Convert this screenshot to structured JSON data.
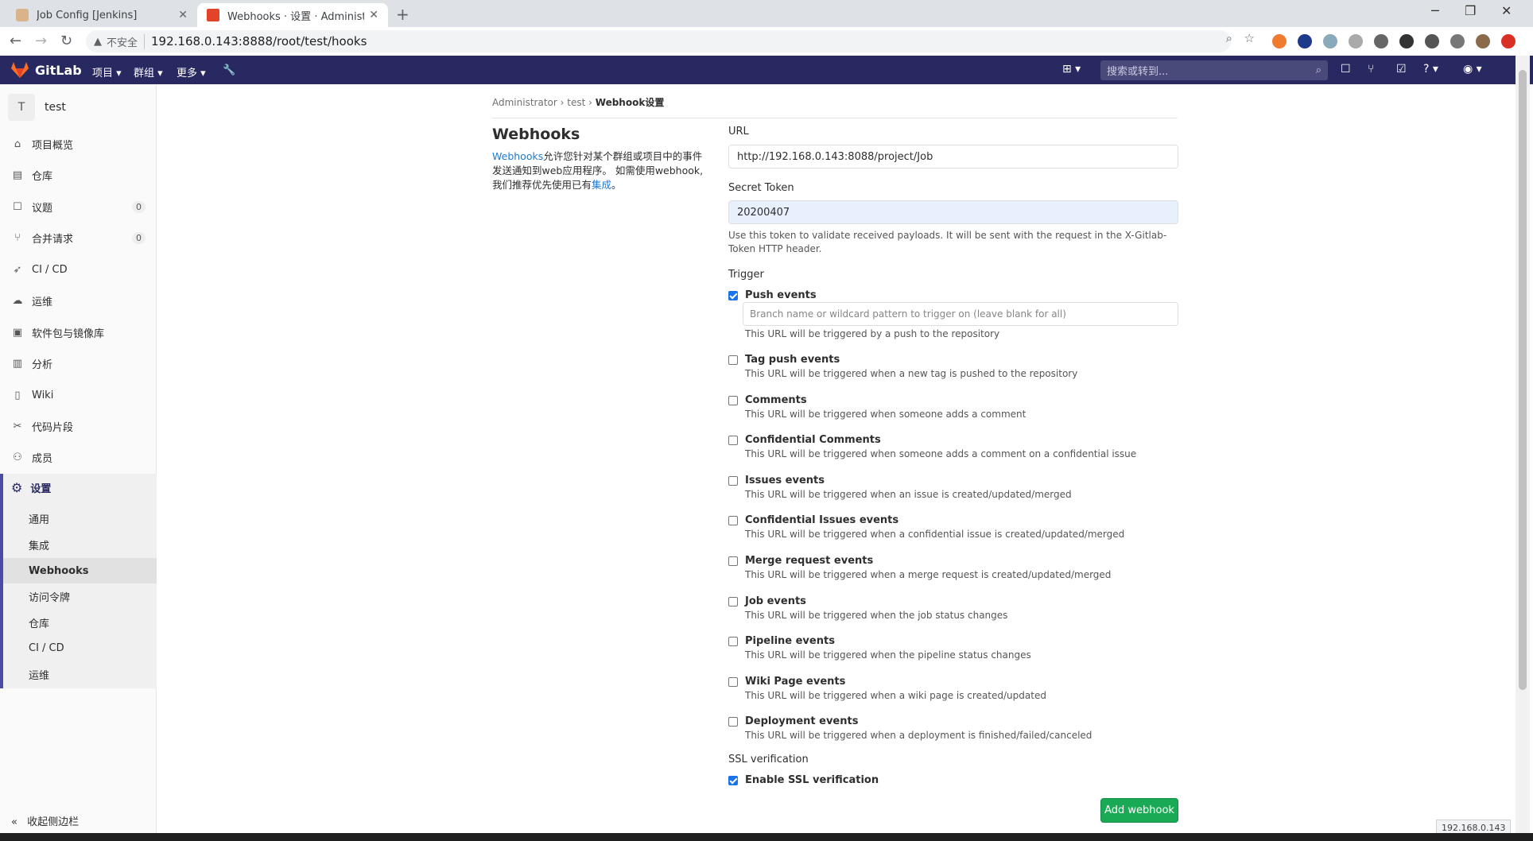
{
  "browser": {
    "tabs": [
      {
        "title": "Job Config [Jenkins]"
      },
      {
        "title": "Webhooks · 设置 · Administrat"
      }
    ],
    "insecure_label": "不安全",
    "url": "192.168.0.143:8888/root/test/hooks"
  },
  "gitlab": {
    "logo": "GitLab",
    "menu": {
      "projects": "项目",
      "groups": "群组",
      "more": "更多"
    },
    "search_placeholder": "搜索或转到..."
  },
  "sidebar": {
    "project_initial": "T",
    "project_name": "test",
    "items": [
      {
        "label": "项目概览",
        "icon": "home-icon"
      },
      {
        "label": "仓库",
        "icon": "doc-icon"
      },
      {
        "label": "议题",
        "icon": "issues-icon",
        "count": "0"
      },
      {
        "label": "合并请求",
        "icon": "merge-icon",
        "count": "0"
      },
      {
        "label": "CI / CD",
        "icon": "rocket-icon"
      },
      {
        "label": "运维",
        "icon": "cloud-icon"
      },
      {
        "label": "软件包与镜像库",
        "icon": "package-icon"
      },
      {
        "label": "分析",
        "icon": "chart-icon"
      },
      {
        "label": "Wiki",
        "icon": "book-icon"
      },
      {
        "label": "代码片段",
        "icon": "scissors-icon"
      },
      {
        "label": "成员",
        "icon": "users-icon"
      }
    ],
    "settings_label": "设置",
    "settings_sub": [
      "通用",
      "集成",
      "Webhooks",
      "访问令牌",
      "仓库",
      "CI / CD",
      "运维"
    ],
    "collapse_label": "收起侧边栏"
  },
  "breadcrumb": {
    "a": "Administrator",
    "b": "test",
    "c": "Webhook设置"
  },
  "page": {
    "title": "Webhooks",
    "desc_link": "Webhooks",
    "desc_text": "允许您针对某个群组或项目中的事件发送通知到web应用程序。 如需使用webhook,我们推荐优先使用已有",
    "desc_link2": "集成",
    "desc_end": "。"
  },
  "form": {
    "url_label": "URL",
    "url_value": "http://192.168.0.143:8088/project/Job",
    "token_label": "Secret Token",
    "token_value": "20200407",
    "token_help": "Use this token to validate received payloads. It will be sent with the request in the X-Gitlab-Token HTTP header.",
    "trigger_label": "Trigger",
    "branch_placeholder": "Branch name or wildcard pattern to trigger on (leave blank for all)",
    "triggers": [
      {
        "name": "Push events",
        "desc": "This URL will be triggered by a push to the repository",
        "checked": true
      },
      {
        "name": "Tag push events",
        "desc": "This URL will be triggered when a new tag is pushed to the repository",
        "checked": false
      },
      {
        "name": "Comments",
        "desc": "This URL will be triggered when someone adds a comment",
        "checked": false
      },
      {
        "name": "Confidential Comments",
        "desc": "This URL will be triggered when someone adds a comment on a confidential issue",
        "checked": false
      },
      {
        "name": "Issues events",
        "desc": "This URL will be triggered when an issue is created/updated/merged",
        "checked": false
      },
      {
        "name": "Confidential Issues events",
        "desc": "This URL will be triggered when a confidential issue is created/updated/merged",
        "checked": false
      },
      {
        "name": "Merge request events",
        "desc": "This URL will be triggered when a merge request is created/updated/merged",
        "checked": false
      },
      {
        "name": "Job events",
        "desc": "This URL will be triggered when the job status changes",
        "checked": false
      },
      {
        "name": "Pipeline events",
        "desc": "This URL will be triggered when the pipeline status changes",
        "checked": false
      },
      {
        "name": "Wiki Page events",
        "desc": "This URL will be triggered when a wiki page is created/updated",
        "checked": false
      },
      {
        "name": "Deployment events",
        "desc": "This URL will be triggered when a deployment is finished/failed/canceled",
        "checked": false
      }
    ],
    "ssl_label": "SSL verification",
    "ssl_name": "Enable SSL verification",
    "ssl_checked": true,
    "submit_label": "Add webhook"
  },
  "status_bar": "192.168.0.143",
  "colors": {
    "header": "#292961",
    "accent": "#1aaa55",
    "link": "#1f78d1"
  }
}
